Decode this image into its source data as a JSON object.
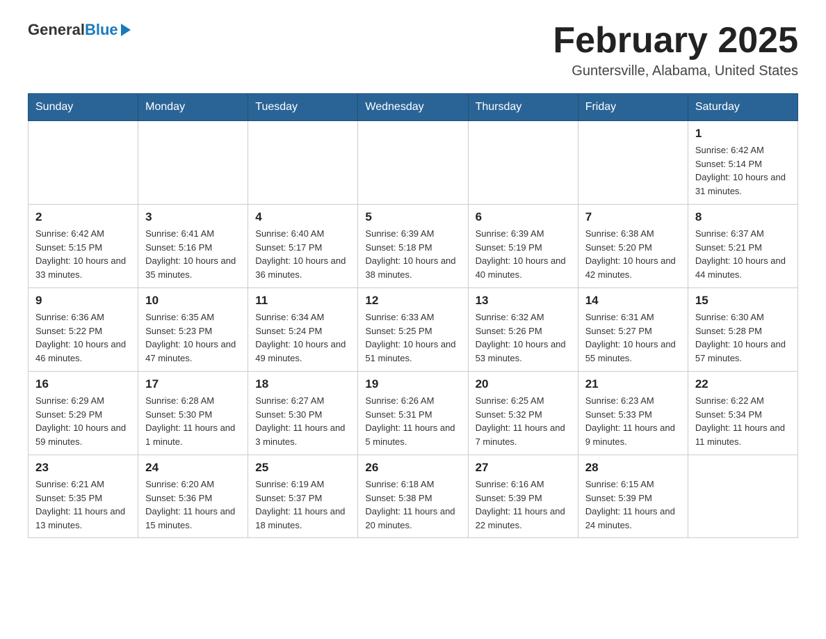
{
  "logo": {
    "general": "General",
    "blue": "Blue"
  },
  "header": {
    "title": "February 2025",
    "subtitle": "Guntersville, Alabama, United States"
  },
  "weekdays": [
    "Sunday",
    "Monday",
    "Tuesday",
    "Wednesday",
    "Thursday",
    "Friday",
    "Saturday"
  ],
  "weeks": [
    [
      {
        "day": "",
        "info": ""
      },
      {
        "day": "",
        "info": ""
      },
      {
        "day": "",
        "info": ""
      },
      {
        "day": "",
        "info": ""
      },
      {
        "day": "",
        "info": ""
      },
      {
        "day": "",
        "info": ""
      },
      {
        "day": "1",
        "info": "Sunrise: 6:42 AM\nSunset: 5:14 PM\nDaylight: 10 hours and 31 minutes."
      }
    ],
    [
      {
        "day": "2",
        "info": "Sunrise: 6:42 AM\nSunset: 5:15 PM\nDaylight: 10 hours and 33 minutes."
      },
      {
        "day": "3",
        "info": "Sunrise: 6:41 AM\nSunset: 5:16 PM\nDaylight: 10 hours and 35 minutes."
      },
      {
        "day": "4",
        "info": "Sunrise: 6:40 AM\nSunset: 5:17 PM\nDaylight: 10 hours and 36 minutes."
      },
      {
        "day": "5",
        "info": "Sunrise: 6:39 AM\nSunset: 5:18 PM\nDaylight: 10 hours and 38 minutes."
      },
      {
        "day": "6",
        "info": "Sunrise: 6:39 AM\nSunset: 5:19 PM\nDaylight: 10 hours and 40 minutes."
      },
      {
        "day": "7",
        "info": "Sunrise: 6:38 AM\nSunset: 5:20 PM\nDaylight: 10 hours and 42 minutes."
      },
      {
        "day": "8",
        "info": "Sunrise: 6:37 AM\nSunset: 5:21 PM\nDaylight: 10 hours and 44 minutes."
      }
    ],
    [
      {
        "day": "9",
        "info": "Sunrise: 6:36 AM\nSunset: 5:22 PM\nDaylight: 10 hours and 46 minutes."
      },
      {
        "day": "10",
        "info": "Sunrise: 6:35 AM\nSunset: 5:23 PM\nDaylight: 10 hours and 47 minutes."
      },
      {
        "day": "11",
        "info": "Sunrise: 6:34 AM\nSunset: 5:24 PM\nDaylight: 10 hours and 49 minutes."
      },
      {
        "day": "12",
        "info": "Sunrise: 6:33 AM\nSunset: 5:25 PM\nDaylight: 10 hours and 51 minutes."
      },
      {
        "day": "13",
        "info": "Sunrise: 6:32 AM\nSunset: 5:26 PM\nDaylight: 10 hours and 53 minutes."
      },
      {
        "day": "14",
        "info": "Sunrise: 6:31 AM\nSunset: 5:27 PM\nDaylight: 10 hours and 55 minutes."
      },
      {
        "day": "15",
        "info": "Sunrise: 6:30 AM\nSunset: 5:28 PM\nDaylight: 10 hours and 57 minutes."
      }
    ],
    [
      {
        "day": "16",
        "info": "Sunrise: 6:29 AM\nSunset: 5:29 PM\nDaylight: 10 hours and 59 minutes."
      },
      {
        "day": "17",
        "info": "Sunrise: 6:28 AM\nSunset: 5:30 PM\nDaylight: 11 hours and 1 minute."
      },
      {
        "day": "18",
        "info": "Sunrise: 6:27 AM\nSunset: 5:30 PM\nDaylight: 11 hours and 3 minutes."
      },
      {
        "day": "19",
        "info": "Sunrise: 6:26 AM\nSunset: 5:31 PM\nDaylight: 11 hours and 5 minutes."
      },
      {
        "day": "20",
        "info": "Sunrise: 6:25 AM\nSunset: 5:32 PM\nDaylight: 11 hours and 7 minutes."
      },
      {
        "day": "21",
        "info": "Sunrise: 6:23 AM\nSunset: 5:33 PM\nDaylight: 11 hours and 9 minutes."
      },
      {
        "day": "22",
        "info": "Sunrise: 6:22 AM\nSunset: 5:34 PM\nDaylight: 11 hours and 11 minutes."
      }
    ],
    [
      {
        "day": "23",
        "info": "Sunrise: 6:21 AM\nSunset: 5:35 PM\nDaylight: 11 hours and 13 minutes."
      },
      {
        "day": "24",
        "info": "Sunrise: 6:20 AM\nSunset: 5:36 PM\nDaylight: 11 hours and 15 minutes."
      },
      {
        "day": "25",
        "info": "Sunrise: 6:19 AM\nSunset: 5:37 PM\nDaylight: 11 hours and 18 minutes."
      },
      {
        "day": "26",
        "info": "Sunrise: 6:18 AM\nSunset: 5:38 PM\nDaylight: 11 hours and 20 minutes."
      },
      {
        "day": "27",
        "info": "Sunrise: 6:16 AM\nSunset: 5:39 PM\nDaylight: 11 hours and 22 minutes."
      },
      {
        "day": "28",
        "info": "Sunrise: 6:15 AM\nSunset: 5:39 PM\nDaylight: 11 hours and 24 minutes."
      },
      {
        "day": "",
        "info": ""
      }
    ]
  ]
}
